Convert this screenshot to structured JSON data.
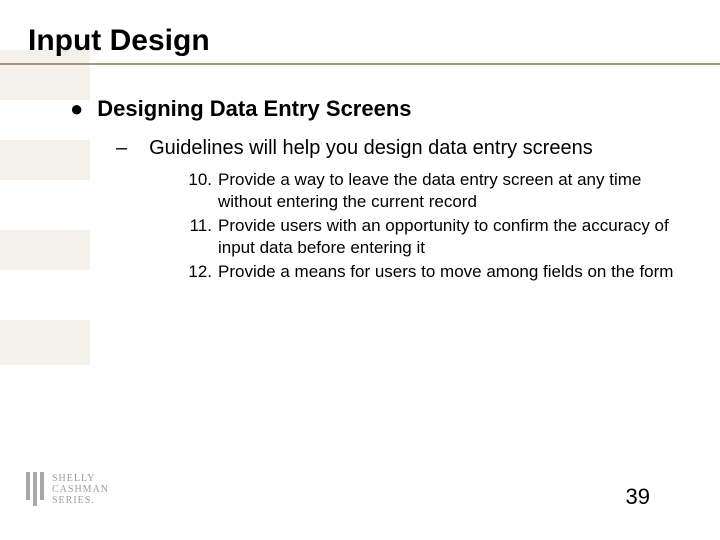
{
  "title": "Input Design",
  "level1": {
    "bullet": "●",
    "text": "Designing Data Entry Screens"
  },
  "level2": {
    "dash": "–",
    "text": "Guidelines will help you design data entry screens"
  },
  "numbered": [
    {
      "n": "10.",
      "t": "Provide a way to leave the data entry screen at any time without entering the current record"
    },
    {
      "n": "11.",
      "t": "Provide users with an opportunity to confirm the accuracy of input data before entering it"
    },
    {
      "n": "12.",
      "t": "Provide a means for users to move among fields on the form"
    }
  ],
  "logo": {
    "line1": "SHELLY",
    "line2": "CASHMAN",
    "line3": "SERIES."
  },
  "page_number": "39"
}
